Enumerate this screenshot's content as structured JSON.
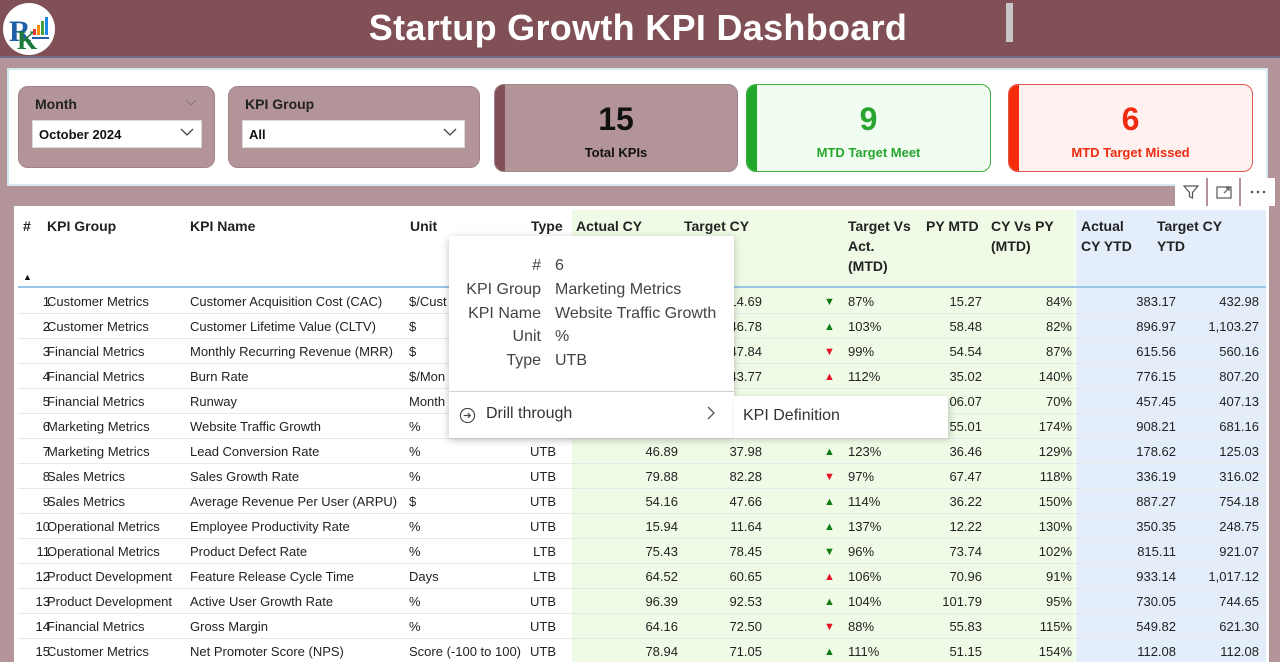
{
  "header": {
    "title": "Startup Growth KPI Dashboard",
    "logo": "company-logo"
  },
  "slicers": {
    "month": {
      "label": "Month",
      "value": "October 2024"
    },
    "kpi_group": {
      "label": "KPI Group",
      "value": "All"
    }
  },
  "cards": {
    "total": {
      "value": "15",
      "label": "Total KPIs"
    },
    "meet": {
      "value": "9",
      "label": "MTD Target Meet",
      "color": "#28a52e"
    },
    "missed": {
      "value": "6",
      "label": "MTD Target Missed",
      "color": "#ef2b10"
    }
  },
  "visual_header": {
    "icons": [
      "filter-icon",
      "focus-mode-icon",
      "more-options-icon"
    ]
  },
  "table": {
    "columns": {
      "num": "#",
      "group": "KPI Group",
      "name": "KPI Name",
      "unit": "Unit",
      "type": "Type",
      "actual_cy": "Actual CY",
      "target_cy": "Target CY",
      "tva_1": "Target Vs",
      "tva_2": "Act.",
      "tva_3": "(MTD)",
      "py_mtd": "PY MTD",
      "cvp_1": "CY Vs PY",
      "cvp_2": "(MTD)",
      "aytd_1": "Actual",
      "aytd_2": "CY YTD",
      "tytd_1": "Target CY",
      "tytd_2": "YTD"
    },
    "sort_indicator": "▲",
    "rows": [
      {
        "num": "1",
        "group": "Customer Metrics",
        "name": "Customer Acquisition Cost (CAC)",
        "unit": "$/Cust",
        "type": "",
        "actual": "",
        "target": "14.69",
        "arrow": "▼",
        "arrow_class": "down-green",
        "tva": "87%",
        "py": "15.27",
        "cvp": "84%",
        "aytd": "383.17",
        "tytd": "432.98"
      },
      {
        "num": "2",
        "group": "Customer Metrics",
        "name": "Customer Lifetime Value (CLTV)",
        "unit": "$",
        "type": "",
        "actual": "",
        "target": "46.78",
        "arrow": "▲",
        "arrow_class": "up-green",
        "tva": "103%",
        "py": "58.48",
        "cvp": "82%",
        "aytd": "896.97",
        "tytd": "1,103.27"
      },
      {
        "num": "3",
        "group": "Financial Metrics",
        "name": "Monthly Recurring Revenue (MRR)",
        "unit": "$",
        "type": "",
        "actual": "",
        "target": "47.84",
        "arrow": "▼",
        "arrow_class": "down-red",
        "tva": "99%",
        "py": "54.54",
        "cvp": "87%",
        "aytd": "615.56",
        "tytd": "560.16"
      },
      {
        "num": "4",
        "group": "Financial Metrics",
        "name": "Burn Rate",
        "unit": "$/Mon",
        "type": "",
        "actual": "",
        "target": "43.77",
        "arrow": "▲",
        "arrow_class": "up-red",
        "tva": "112%",
        "py": "35.02",
        "cvp": "140%",
        "aytd": "776.15",
        "tytd": "807.20"
      },
      {
        "num": "5",
        "group": "Financial Metrics",
        "name": "Runway",
        "unit": "Month",
        "type": "",
        "actual": "",
        "target": "",
        "arrow": "",
        "arrow_class": "",
        "tva": "",
        "py": "06.07",
        "cvp": "70%",
        "aytd": "457.45",
        "tytd": "407.13"
      },
      {
        "num": "6",
        "group": "Marketing Metrics",
        "name": "Website Traffic Growth",
        "unit": "%",
        "type": "",
        "actual": "",
        "target": "",
        "arrow": "",
        "arrow_class": "",
        "tva": "",
        "py": "55.01",
        "cvp": "174%",
        "aytd": "908.21",
        "tytd": "681.16"
      },
      {
        "num": "7",
        "group": "Marketing Metrics",
        "name": "Lead Conversion Rate",
        "unit": "%",
        "type": "UTB",
        "actual": "46.89",
        "target": "37.98",
        "arrow": "▲",
        "arrow_class": "up-green",
        "tva": "123%",
        "py": "36.46",
        "cvp": "129%",
        "aytd": "178.62",
        "tytd": "125.03"
      },
      {
        "num": "8",
        "group": "Sales Metrics",
        "name": "Sales Growth Rate",
        "unit": "%",
        "type": "UTB",
        "actual": "79.88",
        "target": "82.28",
        "arrow": "▼",
        "arrow_class": "down-red",
        "tva": "97%",
        "py": "67.47",
        "cvp": "118%",
        "aytd": "336.19",
        "tytd": "316.02"
      },
      {
        "num": "9",
        "group": "Sales Metrics",
        "name": "Average Revenue Per User (ARPU)",
        "unit": "$",
        "type": "UTB",
        "actual": "54.16",
        "target": "47.66",
        "arrow": "▲",
        "arrow_class": "up-green",
        "tva": "114%",
        "py": "36.22",
        "cvp": "150%",
        "aytd": "887.27",
        "tytd": "754.18"
      },
      {
        "num": "10",
        "group": "Operational Metrics",
        "name": "Employee Productivity Rate",
        "unit": "%",
        "type": "UTB",
        "actual": "15.94",
        "target": "11.64",
        "arrow": "▲",
        "arrow_class": "up-green",
        "tva": "137%",
        "py": "12.22",
        "cvp": "130%",
        "aytd": "350.35",
        "tytd": "248.75"
      },
      {
        "num": "11",
        "group": "Operational Metrics",
        "name": "Product Defect Rate",
        "unit": "%",
        "type": "LTB",
        "actual": "75.43",
        "target": "78.45",
        "arrow": "▼",
        "arrow_class": "down-green",
        "tva": "96%",
        "py": "73.74",
        "cvp": "102%",
        "aytd": "815.11",
        "tytd": "921.07"
      },
      {
        "num": "12",
        "group": "Product Development",
        "name": "Feature Release Cycle Time",
        "unit": "Days",
        "type": "LTB",
        "actual": "64.52",
        "target": "60.65",
        "arrow": "▲",
        "arrow_class": "up-red",
        "tva": "106%",
        "py": "70.96",
        "cvp": "91%",
        "aytd": "933.14",
        "tytd": "1,017.12"
      },
      {
        "num": "13",
        "group": "Product Development",
        "name": "Active User Growth Rate",
        "unit": "%",
        "type": "UTB",
        "actual": "96.39",
        "target": "92.53",
        "arrow": "▲",
        "arrow_class": "up-green",
        "tva": "104%",
        "py": "101.79",
        "cvp": "95%",
        "aytd": "730.05",
        "tytd": "744.65"
      },
      {
        "num": "14",
        "group": "Financial Metrics",
        "name": "Gross Margin",
        "unit": "%",
        "type": "UTB",
        "actual": "64.16",
        "target": "72.50",
        "arrow": "▼",
        "arrow_class": "down-red",
        "tva": "88%",
        "py": "55.83",
        "cvp": "115%",
        "aytd": "549.82",
        "tytd": "621.30"
      },
      {
        "num": "15",
        "group": "Customer Metrics",
        "name": "Net Promoter Score (NPS)",
        "unit": "Score (-100 to 100)",
        "type": "UTB",
        "actual": "78.94",
        "target": "71.05",
        "arrow": "▲",
        "arrow_class": "up-green",
        "tva": "111%",
        "py": "51.15",
        "cvp": "154%",
        "aytd": "112.08",
        "tytd": "112.08"
      }
    ]
  },
  "tooltip": {
    "fields": [
      {
        "key": "#",
        "value": "6"
      },
      {
        "key": "KPI Group",
        "value": "Marketing Metrics"
      },
      {
        "key": "KPI Name",
        "value": "Website Traffic Growth"
      },
      {
        "key": "Unit",
        "value": "%"
      },
      {
        "key": "Type",
        "value": "UTB"
      }
    ],
    "drill_label": "Drill through",
    "submenu_item": "KPI Definition"
  }
}
